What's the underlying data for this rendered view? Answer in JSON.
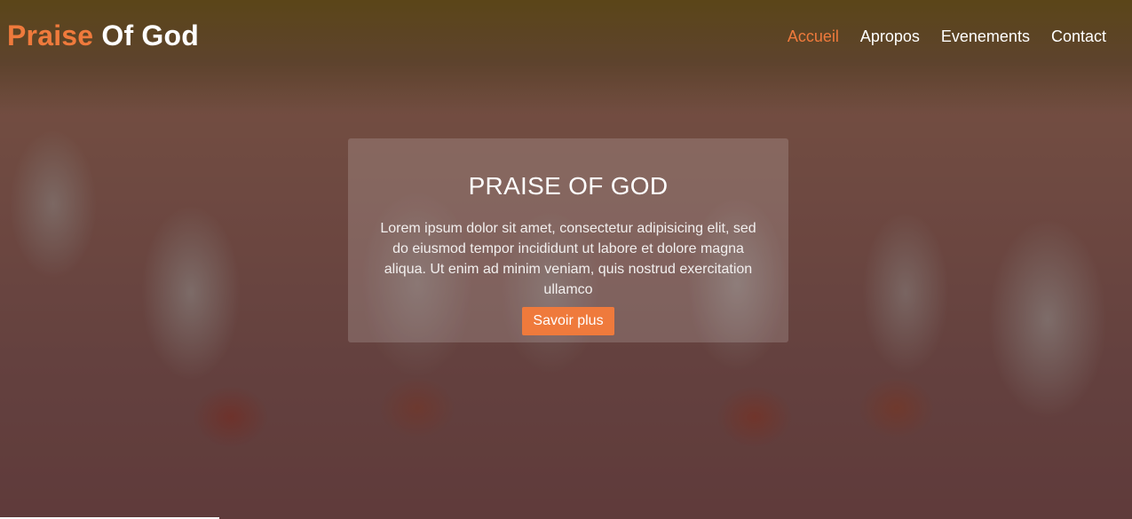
{
  "brand": {
    "accent_text": "Praise",
    "rest_text": "Of God",
    "accent_color": "#ef7a3c"
  },
  "nav": {
    "items": [
      {
        "label": "Accueil",
        "active": true
      },
      {
        "label": "Apropos",
        "active": false
      },
      {
        "label": "Evenements",
        "active": false
      },
      {
        "label": "Contact",
        "active": false
      }
    ]
  },
  "hero": {
    "title": "PRAISE OF GOD",
    "description": "Lorem ipsum dolor sit amet, consectetur adipisicing elit, sed do eiusmod tempor incididunt ut labore et dolore magna aliqua. Ut enim ad minim veniam, quis nostrud exercitation ullamco",
    "button_label": "Savoir plus",
    "background": "group-photo"
  }
}
